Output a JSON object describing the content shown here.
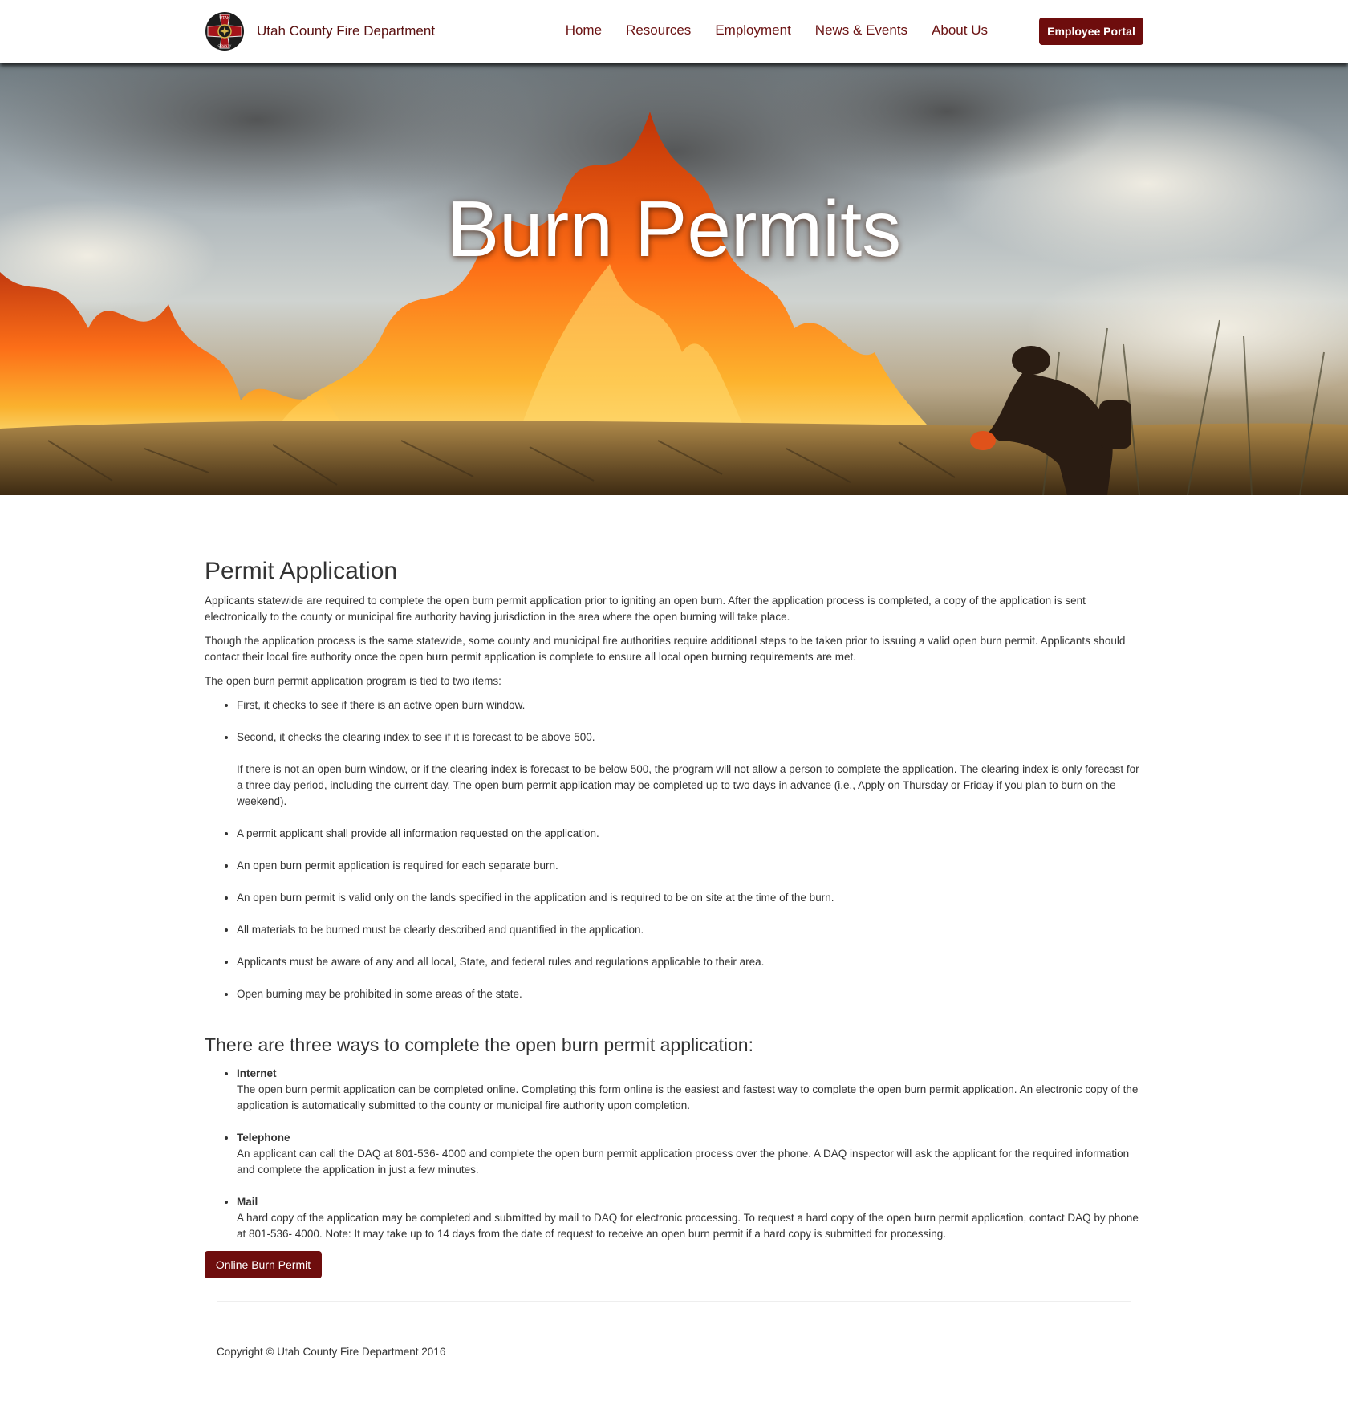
{
  "header": {
    "brand_name": "Utah County Fire Department",
    "nav": {
      "home": "Home",
      "resources": "Resources",
      "employment": "Employment",
      "news_events": "News & Events",
      "about_us": "About Us"
    },
    "employee_portal": "Employee Portal",
    "logo": {
      "icon": "maltese-cross-badge-icon",
      "top_text": "UTAH",
      "bottom_text": "COUNTY"
    }
  },
  "hero": {
    "title": "Burn Permits",
    "image": "wildland-fire-with-firefighter-photo"
  },
  "main": {
    "permit_heading": "Permit Application",
    "intro_p1": "Applicants statewide are required to complete the open burn permit application prior to igniting an open burn. After the application process is completed, a copy of the application is sent electronically to the county or municipal fire authority having jurisdiction in the area where the open burning will take place.",
    "intro_p2": "Though the application process is the same statewide, some county and municipal fire authorities require additional steps to be taken prior to issuing a valid open burn permit. Applicants should contact their local fire authority once the open burn permit application is complete to ensure all local open burning requirements are met.",
    "intro_p3": "The open burn permit application program is tied to two items:",
    "requirements": [
      "First, it checks to see if there is an active open burn window.",
      "Second, it checks the clearing index to see if it is forecast to be above 500.",
      "A permit applicant shall provide all information requested on the application.",
      "An open burn permit application is required for each separate burn.",
      "An open burn permit is valid only on the lands specified in the application and is required to be on site at the time of the burn.",
      "All materials to be burned must be clearly described and quantified in the application.",
      "Applicants must be aware of any and all local, State, and federal rules and regulations applicable to their area.",
      "Open burning may be prohibited in some areas of the state."
    ],
    "clearing_note": "If there is not an open burn window, or if the clearing index is forecast to be below 500, the program will not allow a person to complete the application. The clearing index is only forecast for a three day period, including the current day. The open burn permit application may be completed up to two days in advance (i.e., Apply on Thursday or Friday if you plan to burn on the weekend).",
    "ways_heading": "There are three ways to complete the open burn permit application:",
    "methods": [
      {
        "title": "Internet",
        "text": "The open burn permit application can be completed online. Completing this form online is the easiest and fastest way to complete the open burn permit application. An electronic copy of the application is automatically submitted to the county or municipal fire authority upon completion."
      },
      {
        "title": "Telephone",
        "text": "An applicant can call the DAQ at 801-536- 4000 and complete the open burn permit application process over the phone. A DAQ inspector will ask the applicant for the required information and complete the application in just a few minutes."
      },
      {
        "title": "Mail",
        "text": "A hard copy of the application may be completed and submitted by mail to DAQ for electronic processing. To request a hard copy of the open burn permit application, contact DAQ by phone at 801-536- 4000.  Note: It may take up to 14 days from the date of request to receive an open burn permit if a hard copy is submitted for processing."
      }
    ],
    "online_button": "Online Burn Permit"
  },
  "footer": {
    "copyright": "Copyright © Utah County Fire Department 2016"
  },
  "colors": {
    "brand_maroon": "#6e0d0d",
    "nav_link": "#6b1212",
    "body_text": "#333333"
  }
}
